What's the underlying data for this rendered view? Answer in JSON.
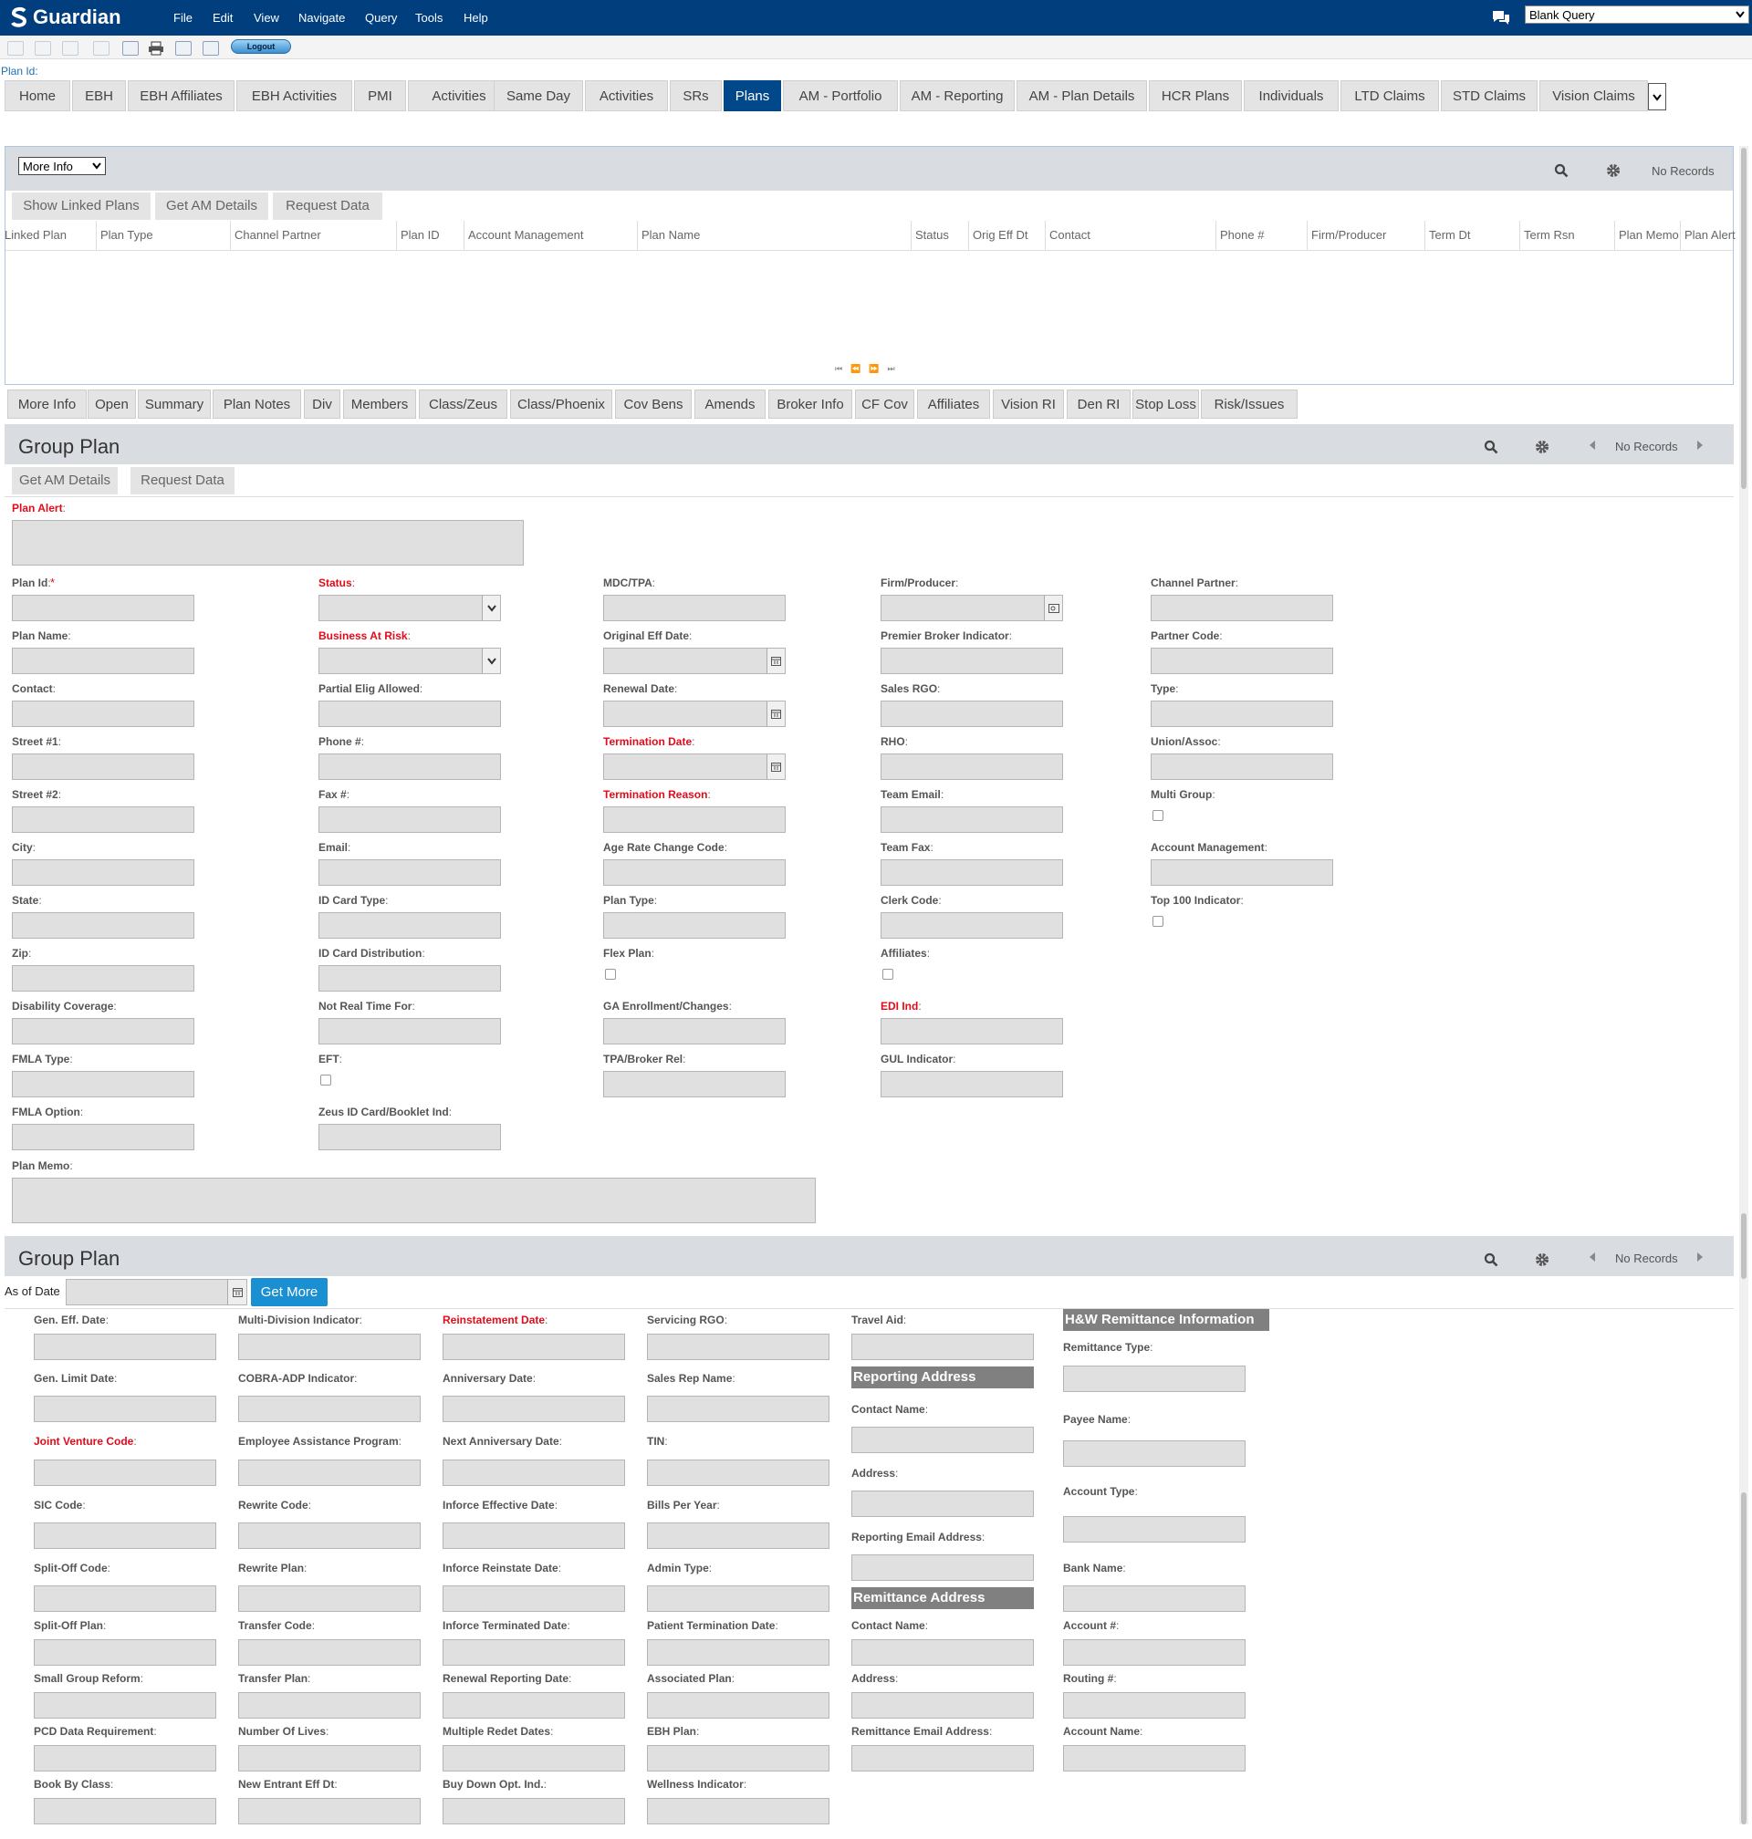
{
  "app": {
    "logo": "Guardian"
  },
  "menu": [
    "File",
    "Edit",
    "View",
    "Navigate",
    "Query",
    "Tools",
    "Help"
  ],
  "query_select": "Blank Query",
  "logout": "Logout",
  "plan_id_label": "Plan Id:",
  "tabs": [
    "Home",
    "EBH",
    "EBH Affiliates",
    "EBH Activities",
    "PMI",
    "Activities",
    "Same Day",
    "Activities",
    "SRs",
    "Plans",
    "AM - Portfolio",
    "AM - Reporting",
    "AM - Plan Details",
    "HCR Plans",
    "Individuals",
    "LTD Claims",
    "STD Claims",
    "Vision Claims"
  ],
  "active_tab": "Plans",
  "list_panel": {
    "more_info": "More Info",
    "no_records": "No Records",
    "buttons": [
      "Show Linked Plans",
      "Get AM Details",
      "Request Data"
    ],
    "columns": [
      "Linked Plan",
      "Plan Type",
      "Channel Partner",
      "Plan ID",
      "Account Management",
      "Plan Name",
      "Status",
      "Orig Eff Dt",
      "Contact",
      "Phone #",
      "Firm/Producer",
      "Term Dt",
      "Term Rsn",
      "Plan Memo",
      "Plan Alert"
    ]
  },
  "subtabs": [
    "More Info",
    "Open",
    "Summary",
    "Plan Notes",
    "Div",
    "Members",
    "Class/Zeus",
    "Class/Phoenix",
    "Cov Bens",
    "Amends",
    "Broker Info",
    "CF Cov",
    "Affiliates",
    "Vision RI",
    "Den RI",
    "Stop Loss",
    "Risk/Issues"
  ],
  "group_plan_1": {
    "title": "Group Plan",
    "no_records": "No Records",
    "buttons": [
      "Get AM Details",
      "Request Data"
    ],
    "plan_alert": "Plan Alert",
    "plan_memo": "Plan Memo",
    "col1": [
      "Plan Id",
      "Plan Name",
      "Contact",
      "Street #1",
      "Street #2",
      "City",
      "State",
      "Zip",
      "Disability Coverage",
      "FMLA Type",
      "FMLA Option"
    ],
    "col2": [
      "Status",
      "Business At Risk",
      "Partial Elig Allowed",
      "Phone #",
      "Fax #",
      "Email",
      "ID Card Type",
      "ID Card Distribution",
      "Not Real Time For",
      "EFT",
      "Zeus ID Card/Booklet Ind"
    ],
    "col3": [
      "MDC/TPA",
      "Original Eff Date",
      "Renewal Date",
      "Termination Date",
      "Termination Reason",
      "Age Rate Change Code",
      "Plan Type",
      "Flex Plan",
      "GA Enrollment/Changes",
      "TPA/Broker Rel"
    ],
    "col4": [
      "Firm/Producer",
      "Premier Broker Indicator",
      "Sales RGO",
      "RHO",
      "Team Email",
      "Team Fax",
      "Clerk Code",
      "Affiliates",
      "EDI Ind",
      "GUL Indicator"
    ],
    "col5": [
      "Channel Partner",
      "Partner Code",
      "Type",
      "Union/Assoc",
      "Multi Group",
      "Account Management",
      "Top 100 Indicator"
    ]
  },
  "group_plan_2": {
    "title": "Group Plan",
    "no_records": "No Records",
    "as_of_date": "As of Date",
    "get_more": "Get More",
    "col1": [
      "Gen. Eff. Date",
      "Gen. Limit Date",
      "Joint Venture Code",
      "SIC Code",
      "Split-Off Code",
      "Split-Off Plan",
      "Small Group Reform",
      "PCD Data Requirement",
      "Book By Class"
    ],
    "col2": [
      "Multi-Division Indicator",
      "COBRA-ADP Indicator",
      "Employee Assistance Program",
      "Rewrite Code",
      "Rewrite Plan",
      "Transfer Code",
      "Transfer Plan",
      "Number Of Lives",
      "New Entrant Eff Dt"
    ],
    "col3": [
      "Reinstatement Date",
      "Anniversary Date",
      "Next Anniversary Date",
      "Inforce Effective Date",
      "Inforce Reinstate Date",
      "Inforce Terminated Date",
      "Renewal Reporting Date",
      "Multiple Redet Dates",
      "Buy Down Opt. Ind."
    ],
    "col4": [
      "Servicing RGO",
      "Sales Rep Name",
      "TIN",
      "Bills Per Year",
      "Admin Type",
      "Patient Termination Date",
      "Associated Plan",
      "EBH Plan",
      "Wellness Indicator"
    ],
    "travel_aid": "Travel Aid",
    "reporting_address": "Reporting Address",
    "reporting_fields": [
      "Contact Name",
      "Address",
      "Reporting Email Address"
    ],
    "remittance_address": "Remittance Address",
    "remittance_fields": [
      "Contact Name",
      "Address",
      "Remittance Email Address"
    ],
    "hw_remittance": "H&W Remittance Information",
    "hw_fields": [
      "Remittance Type",
      "Payee Name",
      "Account Type",
      "Bank Name",
      "Account #",
      "Routing #",
      "Account Name"
    ]
  },
  "colors": {
    "header": "#003e7e",
    "active_tab": "#00488a",
    "required": "#e30b1a",
    "get_more": "#1a8fd1",
    "banner": "#808080"
  }
}
